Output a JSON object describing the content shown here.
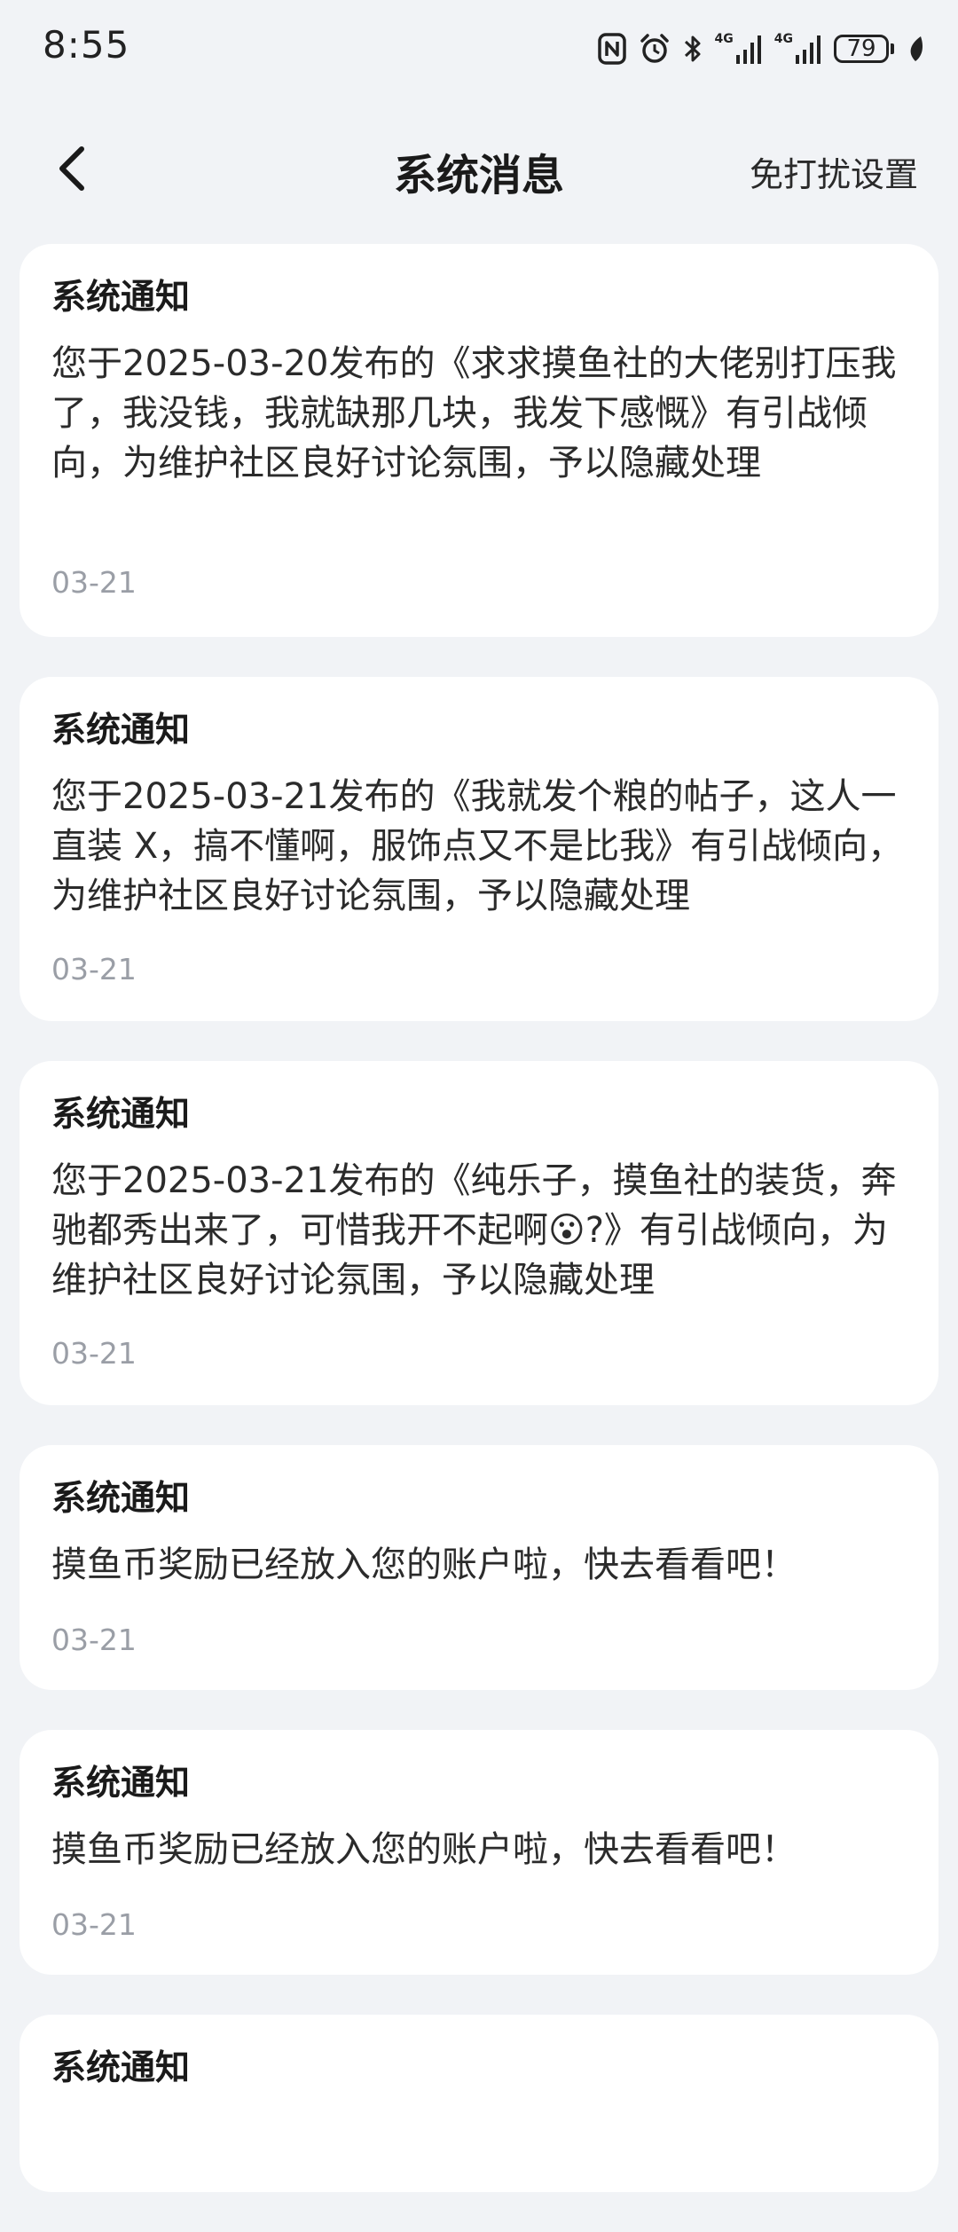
{
  "status_bar": {
    "time": "8:55",
    "net1": "4G",
    "net2": "4G",
    "battery": "79"
  },
  "nav": {
    "title": "系统消息",
    "dnd_label": "免打扰设置"
  },
  "messages": [
    {
      "title": "系统通知",
      "body": "您于2025-03-20发布的《求求摸鱼社的大佬别打压我了，我没钱，我就缺那几块，我发下感慨》有引战倾向，为维护社区良好讨论氛围，予以隐藏处理",
      "date": "03-21"
    },
    {
      "title": "系统通知",
      "body": "您于2025-03-21发布的《我就发个粮的帖子，这人一直装 X，搞不懂啊，服饰点又不是比我》有引战倾向，为维护社区良好讨论氛围，予以隐藏处理",
      "date": "03-21"
    },
    {
      "title": "系统通知",
      "body": "您于2025-03-21发布的《纯乐子，摸鱼社的装货，奔驰都秀出来了，可惜我开不起啊😮?》有引战倾向，为维护社区良好讨论氛围，予以隐藏处理",
      "date": "03-21"
    },
    {
      "title": "系统通知",
      "body": "摸鱼币奖励已经放入您的账户啦，快去看看吧！",
      "date": "03-21"
    },
    {
      "title": "系统通知",
      "body": "摸鱼币奖励已经放入您的账户啦，快去看看吧！",
      "date": "03-21"
    },
    {
      "title": "系统通知"
    }
  ]
}
